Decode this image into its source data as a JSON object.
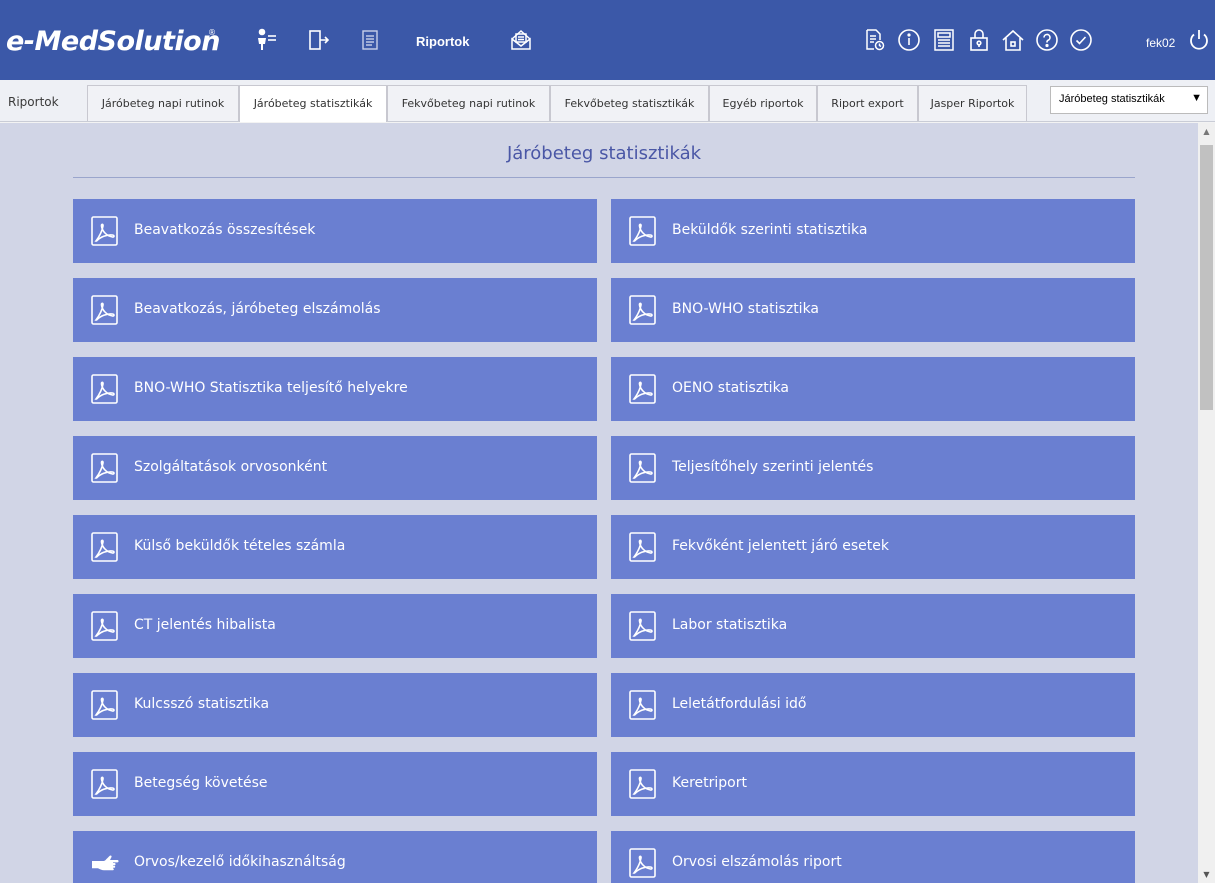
{
  "header": {
    "logo": "e-MedSolution",
    "logo_mark": "®",
    "riportok_label": "Riportok",
    "username": "fek02",
    "icons": [
      "patient-list-icon",
      "exit-door-icon",
      "document-icon",
      "report-mail-icon",
      "report-clock-icon",
      "info-icon",
      "calculator-icon",
      "lock-icon",
      "home-icon",
      "help-icon",
      "check-icon",
      "power-icon"
    ]
  },
  "tabs": {
    "root_label": "Riportok",
    "items": [
      {
        "label": "Járóbeteg napi rutinok"
      },
      {
        "label": "Járóbeteg statisztikák"
      },
      {
        "label": "Fekvőbeteg napi rutinok"
      },
      {
        "label": "Fekvőbeteg statisztikák"
      },
      {
        "label": "Egyéb riportok"
      },
      {
        "label": "Riport export"
      },
      {
        "label": "Jasper Riportok"
      }
    ],
    "active_index": 1,
    "select_value": "Járóbeteg statisztikák"
  },
  "main": {
    "title": "Járóbeteg statisztikák",
    "reports": [
      {
        "label": "Beavatkozás összesítések",
        "icon": "pdf-icon"
      },
      {
        "label": "Beküldők szerinti statisztika",
        "icon": "pdf-icon"
      },
      {
        "label": "Beavatkozás, járóbeteg elszámolás",
        "icon": "pdf-icon"
      },
      {
        "label": "BNO-WHO statisztika",
        "icon": "pdf-icon"
      },
      {
        "label": "BNO-WHO Statisztika teljesítő helyekre",
        "icon": "pdf-icon"
      },
      {
        "label": "OENO statisztika",
        "icon": "pdf-icon"
      },
      {
        "label": "Szolgáltatások orvosonként",
        "icon": "pdf-icon"
      },
      {
        "label": "Teljesítőhely szerinti jelentés",
        "icon": "pdf-icon"
      },
      {
        "label": "Külső beküldők tételes számla",
        "icon": "pdf-icon"
      },
      {
        "label": "Fekvőként jelentett járó esetek",
        "icon": "pdf-icon"
      },
      {
        "label": "CT jelentés hibalista",
        "icon": "pdf-icon"
      },
      {
        "label": "Labor statisztika",
        "icon": "pdf-icon"
      },
      {
        "label": "Kulcsszó statisztika",
        "icon": "pdf-icon"
      },
      {
        "label": "Leletátfordulási idő",
        "icon": "pdf-icon"
      },
      {
        "label": "Betegség követése",
        "icon": "pdf-icon"
      },
      {
        "label": "Keretriport",
        "icon": "pdf-icon"
      },
      {
        "label": "Orvos/kezelő időkihasználtság",
        "icon": "pointing-hand-icon"
      },
      {
        "label": "Orvosi elszámolás riport",
        "icon": "pdf-icon"
      }
    ]
  },
  "scrollbar": {
    "up_arrow": "▲",
    "down_arrow": "▼"
  },
  "colors": {
    "header_bg": "#3b58a8",
    "content_bg": "#d1d5e6",
    "button_bg": "#6a7fd1",
    "title_color": "#4a57a6"
  }
}
